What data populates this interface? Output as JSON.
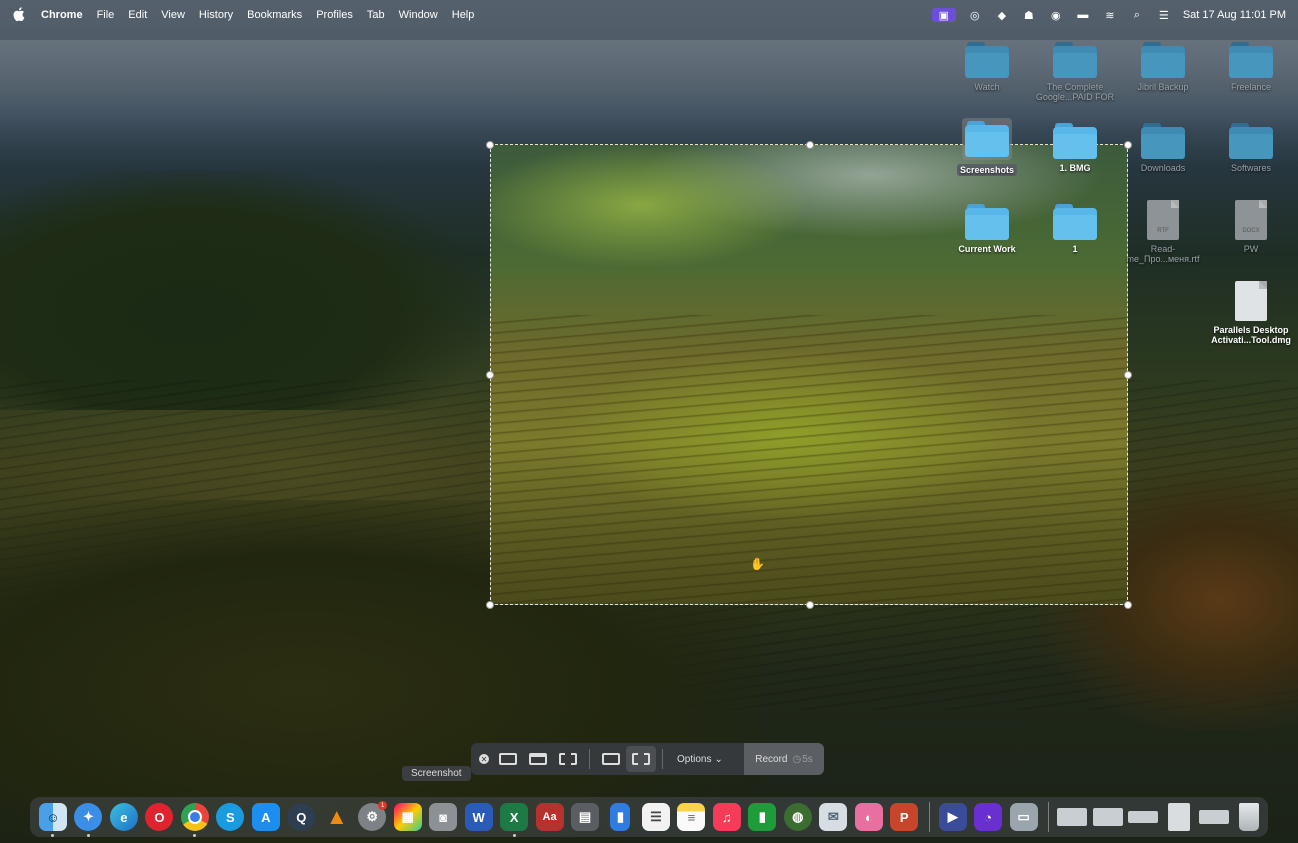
{
  "menubar": {
    "apple": "",
    "app_name": "Chrome",
    "menus": [
      "File",
      "Edit",
      "View",
      "History",
      "Bookmarks",
      "Profiles",
      "Tab",
      "Window",
      "Help"
    ],
    "datetime": "Sat 17 Aug  11:01 PM"
  },
  "desktop": {
    "items": [
      {
        "label": "Watch",
        "kind": "folder",
        "state": "dim"
      },
      {
        "label": "The Complete Google...PAID FOR",
        "kind": "folder",
        "state": "dim"
      },
      {
        "label": "Jibril Backup",
        "kind": "folder",
        "state": "dim"
      },
      {
        "label": "Freelance",
        "kind": "folder",
        "state": "dim"
      },
      {
        "label": "Screenshots",
        "kind": "folder",
        "state": "selected"
      },
      {
        "label": "1. BMG",
        "kind": "folder",
        "state": "normal"
      },
      {
        "label": "Downloads",
        "kind": "folder",
        "state": "dim"
      },
      {
        "label": "Softwares",
        "kind": "folder",
        "state": "dim"
      },
      {
        "label": "Current Work",
        "kind": "folder",
        "state": "normal"
      },
      {
        "label": "1",
        "kind": "folder",
        "state": "normal"
      },
      {
        "label": "Read-me_Про...меня.rtf",
        "kind": "document",
        "state": "dim",
        "tag": "RTF"
      },
      {
        "label": "PW",
        "kind": "document",
        "state": "dim",
        "tag": "DOCX"
      },
      {
        "label": "Parallels Desktop Activati...Tool.dmg",
        "kind": "disk-image",
        "state": "normal"
      }
    ]
  },
  "screenshot_toolbar": {
    "tooltip": "Screenshot",
    "options_label": "Options",
    "record_label": "Record",
    "timer_label": "5s"
  },
  "dock": {
    "apps": [
      "Finder",
      "Safari",
      "Edge",
      "Opera",
      "Chrome",
      "Skype",
      "App Store",
      "QuickTime",
      "VLC",
      "System Settings",
      "Launchpad",
      "Screenshot",
      "Word",
      "Excel",
      "Dictionary",
      "Calculator",
      "Files",
      "Reminders",
      "Notes",
      "Music",
      "Numbers",
      "Keynote",
      "Preview",
      "CleanMyMac",
      "PowerPoint",
      "Screens",
      "Terminal",
      "Parallels"
    ]
  },
  "colors": {
    "accent": "#6c4fd8",
    "folder": "#58b7e8"
  }
}
